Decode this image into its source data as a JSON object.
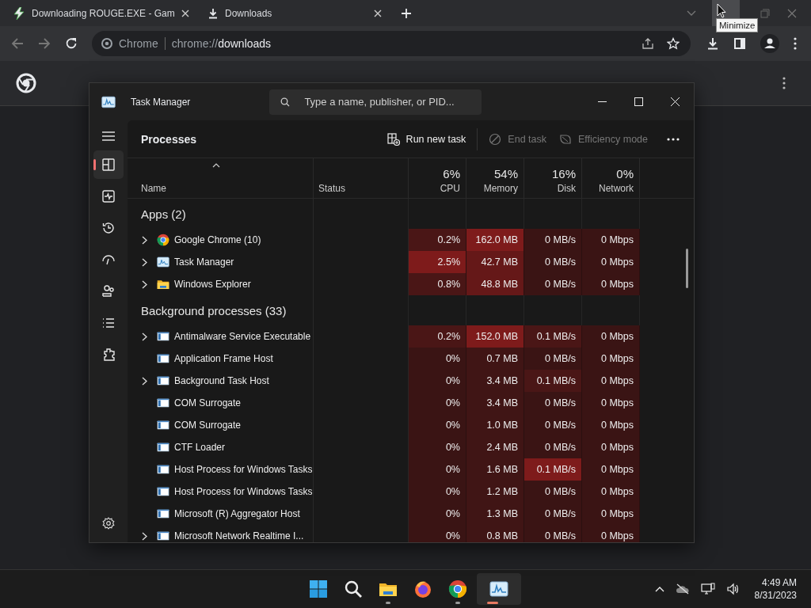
{
  "browser": {
    "tabs": [
      {
        "title": "Downloading ROUGE.EXE - Gam"
      },
      {
        "title": "Downloads"
      }
    ],
    "tooltip": "Minimize",
    "omnibox": {
      "chip": "Chrome",
      "scheme": "chrome://",
      "path": "downloads"
    }
  },
  "task_manager": {
    "title": "Task Manager",
    "search_placeholder": "Type a name, publisher, or PID...",
    "nav": [
      {
        "selected": true
      },
      {
        "selected": false
      },
      {
        "selected": false
      },
      {
        "selected": false
      },
      {
        "selected": false
      },
      {
        "selected": false
      },
      {
        "selected": false
      }
    ],
    "page_title": "Processes",
    "actions": [
      {
        "label": "Run new task",
        "disabled": false
      },
      {
        "label": "End task",
        "disabled": true
      },
      {
        "label": "Efficiency mode",
        "disabled": true
      }
    ],
    "columns": [
      {
        "label": "Name",
        "kind": "name",
        "sorted": true
      },
      {
        "label": "Status",
        "kind": "text"
      },
      {
        "label": "CPU",
        "kind": "metric",
        "total": "6%"
      },
      {
        "label": "Memory",
        "kind": "metric",
        "total": "54%"
      },
      {
        "label": "Disk",
        "kind": "metric",
        "total": "16%"
      },
      {
        "label": "Network",
        "kind": "metric",
        "total": "0%"
      }
    ],
    "rows": [
      {
        "kind": "group",
        "name": "Apps (2)"
      },
      {
        "kind": "chrome",
        "name": "Google Chrome (10)",
        "expandable": true,
        "cells": [
          {
            "text": "0.2%",
            "color": "#4a1616"
          },
          {
            "text": "162.0 MB",
            "color": "#7e1b1b"
          },
          {
            "text": "0 MB/s",
            "color": "#3a1414"
          },
          {
            "text": "0 Mbps",
            "color": "#3a1414"
          }
        ]
      },
      {
        "kind": "taskmgr",
        "name": "Task Manager",
        "expandable": true,
        "cells": [
          {
            "text": "2.5%",
            "color": "#7e1b1b"
          },
          {
            "text": "42.7 MB",
            "color": "#651818"
          },
          {
            "text": "0 MB/s",
            "color": "#3a1414"
          },
          {
            "text": "0 Mbps",
            "color": "#3a1414"
          }
        ]
      },
      {
        "kind": "explorer",
        "name": "Windows Explorer",
        "expandable": true,
        "cells": [
          {
            "text": "0.8%",
            "color": "#4a1616"
          },
          {
            "text": "48.8 MB",
            "color": "#651818"
          },
          {
            "text": "0 MB/s",
            "color": "#3a1414"
          },
          {
            "text": "0 Mbps",
            "color": "#3a1414"
          }
        ]
      },
      {
        "kind": "group",
        "name": "Background processes (33)"
      },
      {
        "kind": "process",
        "name": "Antimalware Service Executable",
        "expandable": true,
        "cells": [
          {
            "text": "0.2%",
            "color": "#4a1616"
          },
          {
            "text": "152.0 MB",
            "color": "#7e1b1b"
          },
          {
            "text": "0.1 MB/s",
            "color": "#4a1616"
          },
          {
            "text": "0 Mbps",
            "color": "#3a1414"
          }
        ]
      },
      {
        "kind": "process",
        "name": "Application Frame Host",
        "expandable": false,
        "cells": [
          {
            "text": "0%",
            "color": "#3a1414"
          },
          {
            "text": "0.7 MB",
            "color": "#401515"
          },
          {
            "text": "0 MB/s",
            "color": "#3a1414"
          },
          {
            "text": "0 Mbps",
            "color": "#3a1414"
          }
        ]
      },
      {
        "kind": "process",
        "name": "Background Task Host",
        "expandable": true,
        "cells": [
          {
            "text": "0%",
            "color": "#3a1414"
          },
          {
            "text": "3.4 MB",
            "color": "#401515"
          },
          {
            "text": "0.1 MB/s",
            "color": "#4a1616"
          },
          {
            "text": "0 Mbps",
            "color": "#3a1414"
          }
        ]
      },
      {
        "kind": "process",
        "name": "COM Surrogate",
        "expandable": false,
        "cells": [
          {
            "text": "0%",
            "color": "#3a1414"
          },
          {
            "text": "3.4 MB",
            "color": "#401515"
          },
          {
            "text": "0 MB/s",
            "color": "#3a1414"
          },
          {
            "text": "0 Mbps",
            "color": "#3a1414"
          }
        ]
      },
      {
        "kind": "process",
        "name": "COM Surrogate",
        "expandable": false,
        "cells": [
          {
            "text": "0%",
            "color": "#3a1414"
          },
          {
            "text": "1.0 MB",
            "color": "#401515"
          },
          {
            "text": "0 MB/s",
            "color": "#3a1414"
          },
          {
            "text": "0 Mbps",
            "color": "#3a1414"
          }
        ]
      },
      {
        "kind": "process",
        "name": "CTF Loader",
        "expandable": false,
        "cells": [
          {
            "text": "0%",
            "color": "#3a1414"
          },
          {
            "text": "2.4 MB",
            "color": "#401515"
          },
          {
            "text": "0 MB/s",
            "color": "#3a1414"
          },
          {
            "text": "0 Mbps",
            "color": "#3a1414"
          }
        ]
      },
      {
        "kind": "process",
        "name": "Host Process for Windows Tasks",
        "expandable": false,
        "cells": [
          {
            "text": "0%",
            "color": "#3a1414"
          },
          {
            "text": "1.6 MB",
            "color": "#401515"
          },
          {
            "text": "0.1 MB/s",
            "color": "#7e1b1b"
          },
          {
            "text": "0 Mbps",
            "color": "#3a1414"
          }
        ]
      },
      {
        "kind": "process",
        "name": "Host Process for Windows Tasks",
        "expandable": false,
        "cells": [
          {
            "text": "0%",
            "color": "#3a1414"
          },
          {
            "text": "1.2 MB",
            "color": "#401515"
          },
          {
            "text": "0 MB/s",
            "color": "#3a1414"
          },
          {
            "text": "0 Mbps",
            "color": "#3a1414"
          }
        ]
      },
      {
        "kind": "process",
        "name": "Microsoft (R) Aggregator Host",
        "expandable": false,
        "cells": [
          {
            "text": "0%",
            "color": "#3a1414"
          },
          {
            "text": "1.3 MB",
            "color": "#401515"
          },
          {
            "text": "0 MB/s",
            "color": "#3a1414"
          },
          {
            "text": "0 Mbps",
            "color": "#3a1414"
          }
        ]
      },
      {
        "kind": "process",
        "name": "Microsoft Network Realtime I...",
        "expandable": true,
        "cells": [
          {
            "text": "0%",
            "color": "#3a1414"
          },
          {
            "text": "0.8 MB",
            "color": "#401515"
          },
          {
            "text": "0 MB/s",
            "color": "#3a1414"
          },
          {
            "text": "0 Mbps",
            "color": "#3a1414"
          }
        ]
      }
    ]
  },
  "taskbar": {
    "apps": [
      {
        "kind": "start",
        "running": false,
        "active": false
      },
      {
        "kind": "search",
        "running": false,
        "active": false
      },
      {
        "kind": "explorer",
        "running": true,
        "active": false
      },
      {
        "kind": "firefox",
        "running": false,
        "active": false
      },
      {
        "kind": "chrome",
        "running": true,
        "active": false
      },
      {
        "kind": "taskmgr",
        "running": true,
        "active": true
      }
    ],
    "time": "4:49 AM",
    "date": "8/31/2023"
  }
}
